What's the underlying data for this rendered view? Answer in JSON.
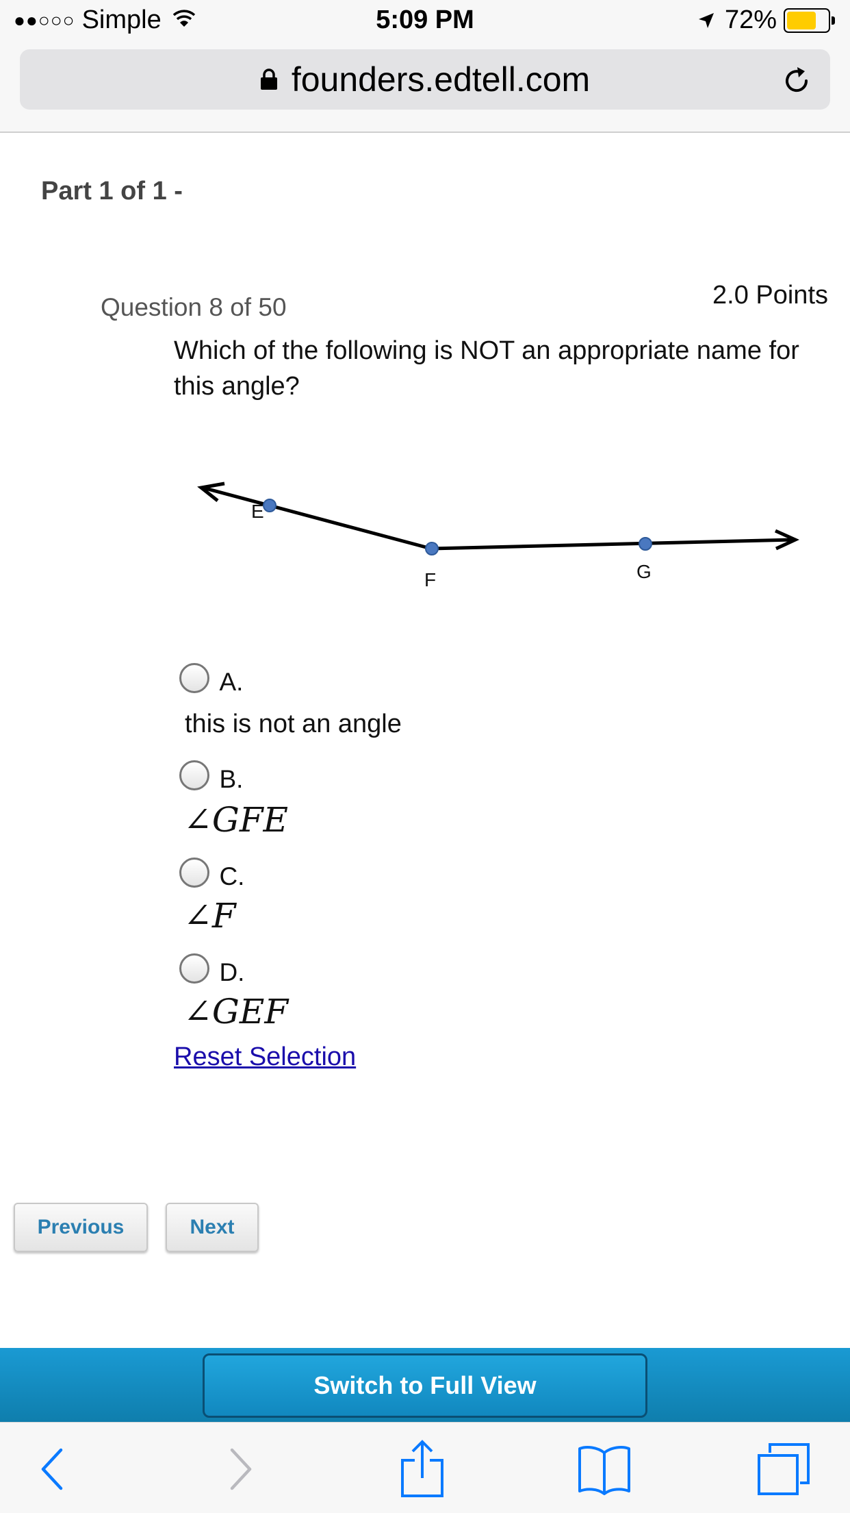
{
  "status_bar": {
    "signal_dots": "●●○○○",
    "carrier": "Simple",
    "time": "5:09 PM",
    "battery_percent": "72%",
    "battery_level": 0.72,
    "battery_color": "#ffcc00"
  },
  "browser": {
    "url": "founders.edtell.com"
  },
  "quiz": {
    "part_title": "Part 1 of 1 -",
    "question_number": "Question 8 of 50",
    "points": "2.0 Points",
    "prompt": "Which of the following is NOT an appropriate name for this angle?",
    "diagram": {
      "point_labels": [
        "E",
        "F",
        "G"
      ]
    },
    "choices": [
      {
        "letter": "A.",
        "text": "this is not an angle"
      },
      {
        "letter": "B.",
        "text": "∠GFE"
      },
      {
        "letter": "C.",
        "text": "∠F"
      },
      {
        "letter": "D.",
        "text": "∠GEF"
      }
    ],
    "reset_label": "Reset Selection"
  },
  "navigation": {
    "previous_label": "Previous",
    "next_label": "Next"
  },
  "full_view": {
    "label": "Switch to Full View"
  },
  "colors": {
    "link": "#1a0dab",
    "nav_text": "#2b7fb1",
    "banner": "#1a9ad3",
    "ios_blue": "#0a7aff"
  },
  "toolbar_icons": [
    "back-icon",
    "forward-icon",
    "share-icon",
    "bookmarks-icon",
    "tabs-icon"
  ]
}
